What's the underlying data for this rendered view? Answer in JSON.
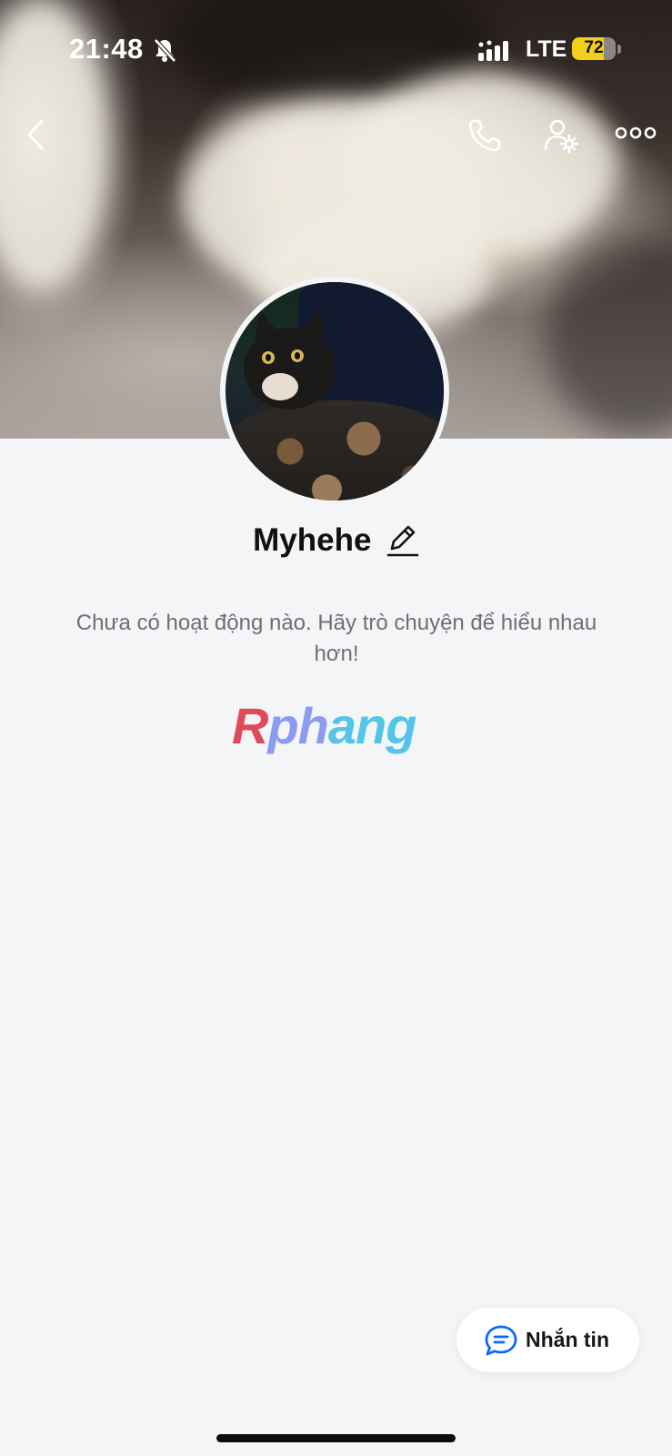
{
  "status_bar": {
    "time": "21:48",
    "network": "LTE",
    "battery": "72",
    "battery_level": 0.72
  },
  "nav": {
    "back_icon": "chevron-left-icon",
    "call_icon": "phone-icon",
    "settings_icon": "user-settings-icon",
    "more_icon": "more-horizontal-icon"
  },
  "profile": {
    "name": "Myhehe",
    "edit_icon": "pencil-icon"
  },
  "activity": {
    "empty_message": "Chưa có hoạt động nào. Hãy trò chuyện để hiểu nhau hơn!"
  },
  "watermark": {
    "text_a": "R",
    "text_b": "ph",
    "text_c": "ang"
  },
  "message_button": {
    "label": "Nhắn tin",
    "icon": "chat-bubble-icon",
    "accent": "#0a68fe"
  }
}
